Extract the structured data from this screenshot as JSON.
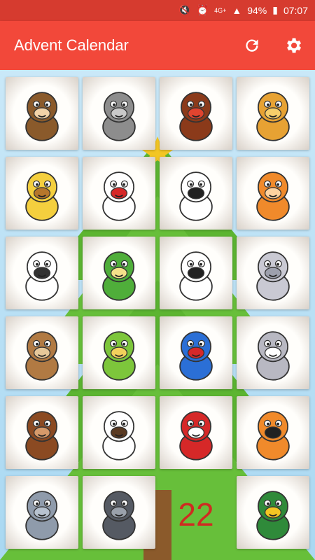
{
  "status_bar": {
    "battery": "94%",
    "time": "07:07",
    "network": "4G+"
  },
  "app": {
    "title": "Advent Calendar",
    "refresh_icon": "refresh-icon",
    "settings_icon": "gear-icon"
  },
  "colors": {
    "appbar": "#f2483a",
    "statusbar": "#d63b2f",
    "day_number": "#cf2b21"
  },
  "tiles": [
    {
      "animal": "monkey"
    },
    {
      "animal": "donkey"
    },
    {
      "animal": "turkey"
    },
    {
      "animal": "lion"
    },
    {
      "animal": "giraffe"
    },
    {
      "animal": "rooster"
    },
    {
      "animal": "cow"
    },
    {
      "animal": "cat"
    },
    {
      "animal": "sheep"
    },
    {
      "animal": "crocodile"
    },
    {
      "animal": "zebra"
    },
    {
      "animal": "hippo"
    },
    {
      "animal": "bear"
    },
    {
      "animal": "snake"
    },
    {
      "animal": "santa-scene"
    },
    {
      "animal": "rabbit"
    },
    {
      "animal": "horse"
    },
    {
      "animal": "dog"
    },
    {
      "animal": "santa-gifts"
    },
    {
      "animal": "tiger"
    },
    {
      "animal": "elephant"
    },
    {
      "animal": "gorilla"
    },
    {
      "animal": "day-22",
      "label": "22"
    },
    {
      "animal": "duck"
    }
  ]
}
